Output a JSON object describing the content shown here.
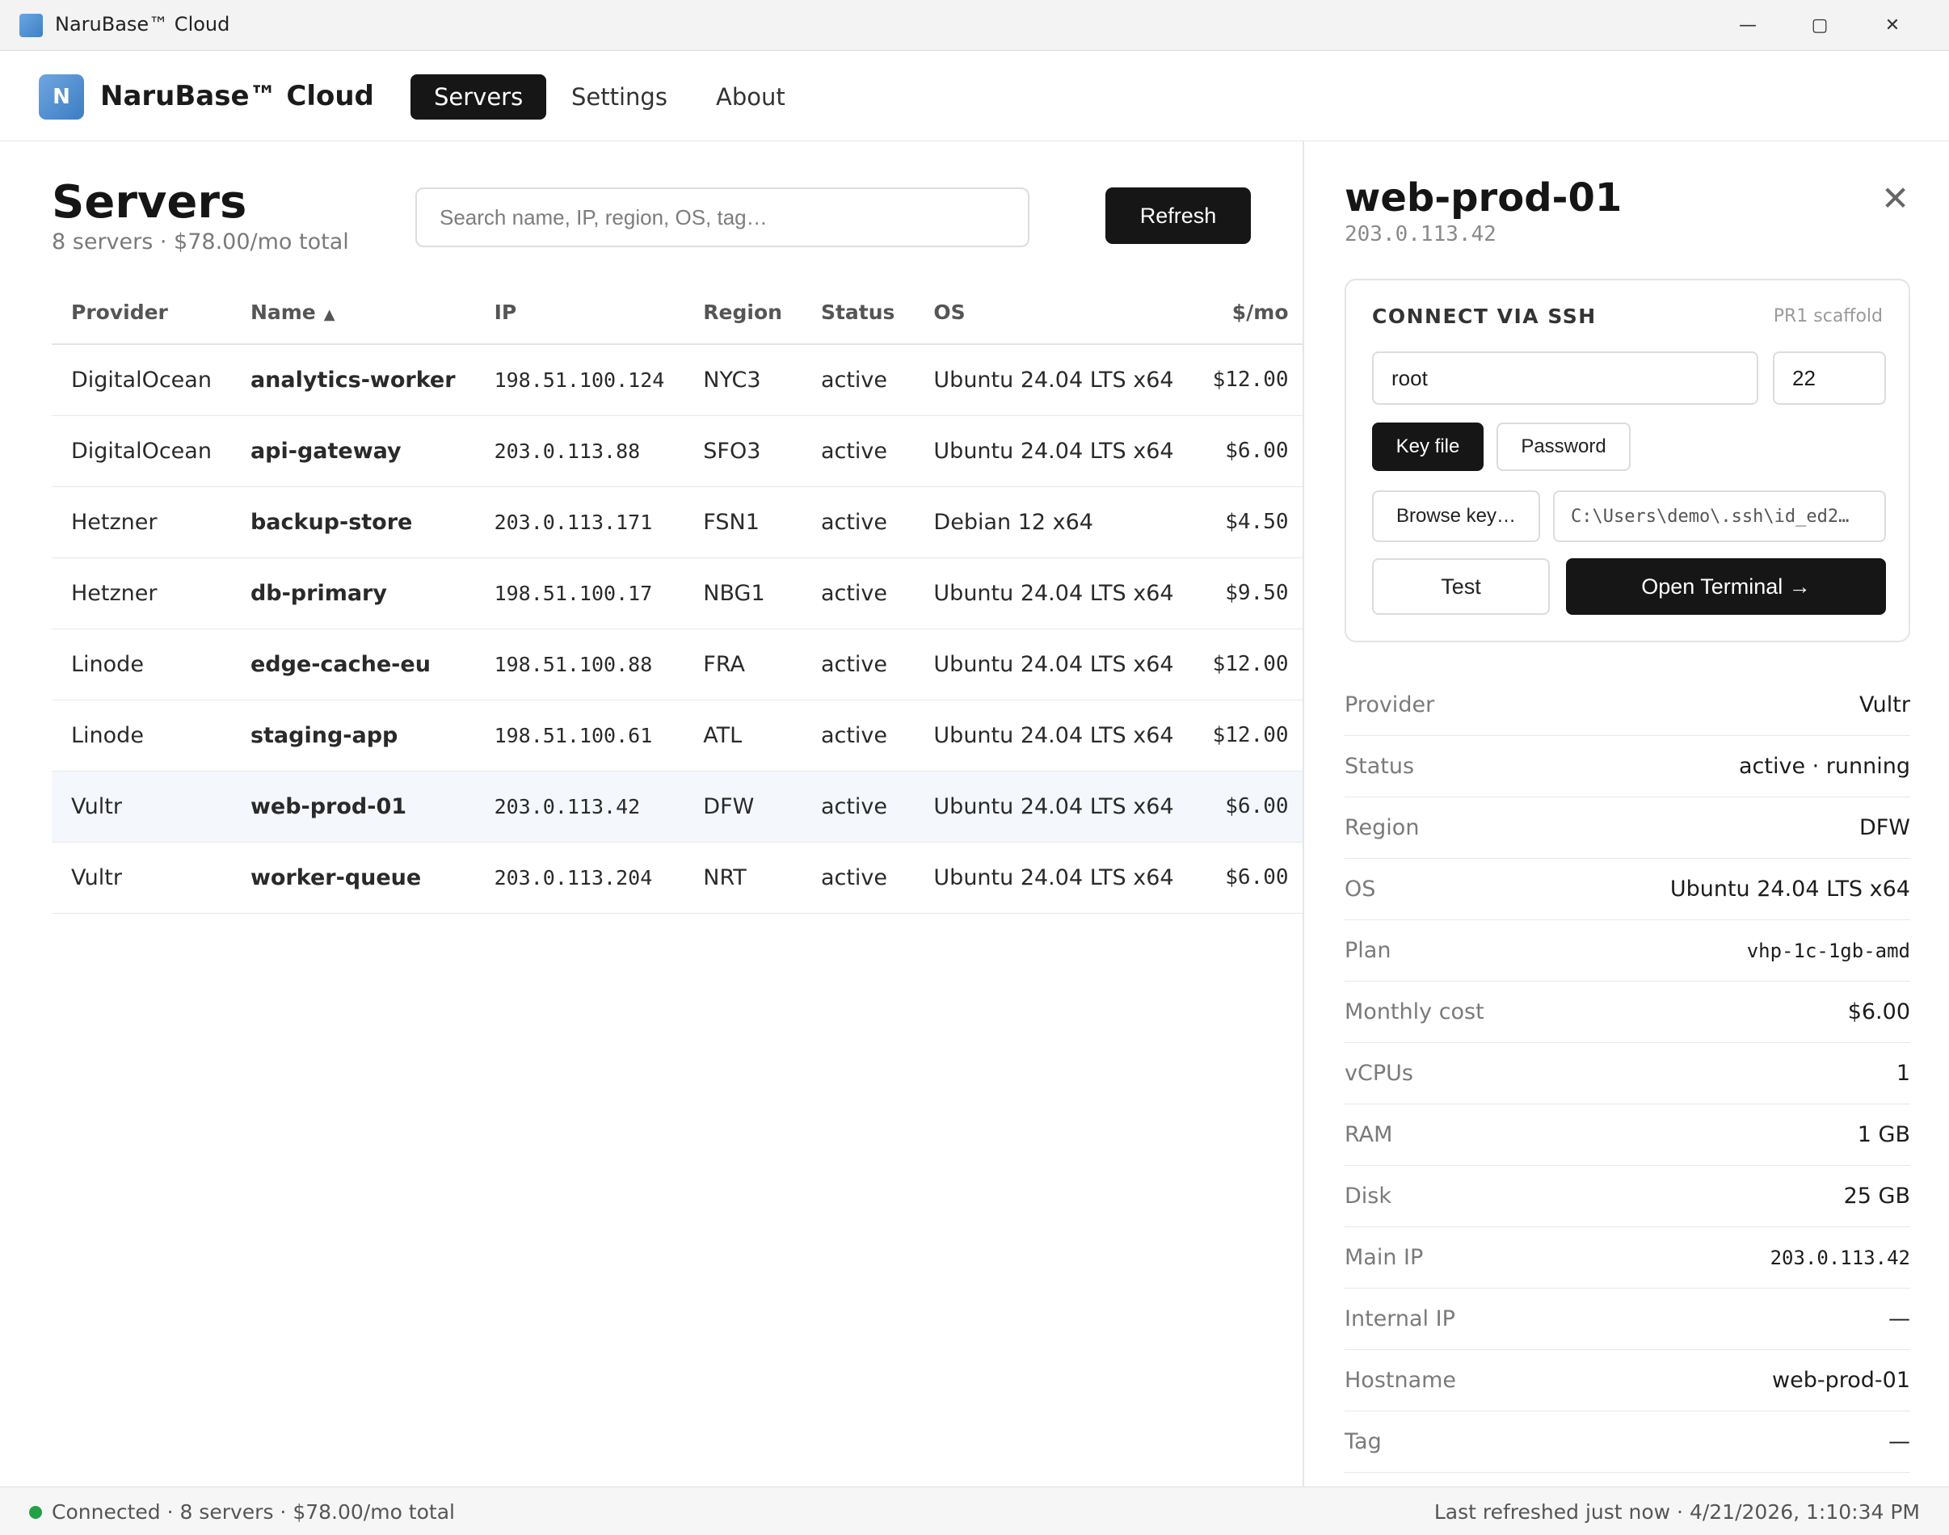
{
  "window": {
    "title": "NaruBase™ Cloud",
    "minimize_glyph": "—",
    "maximize_glyph": "▢",
    "close_glyph": "✕"
  },
  "nav": {
    "logo_letter": "N",
    "brand": "NaruBase™ Cloud",
    "tabs": [
      {
        "label": "Servers",
        "active": true
      },
      {
        "label": "Settings",
        "active": false
      },
      {
        "label": "About",
        "active": false
      }
    ]
  },
  "main": {
    "title": "Servers",
    "subtitle": "8 servers · $78.00/mo total",
    "search_placeholder": "Search name, IP, region, OS, tag…",
    "refresh_label": "Refresh",
    "sort_arrow": "▲",
    "columns": [
      "Provider",
      "Name",
      "IP",
      "Region",
      "Status",
      "OS",
      "$/mo"
    ],
    "rows": [
      {
        "provider": "DigitalOcean",
        "name": "analytics-worker",
        "ip": "198.51.100.124",
        "region": "NYC3",
        "status": "active",
        "os": "Ubuntu 24.04 LTS x64",
        "cost": "$12.00"
      },
      {
        "provider": "DigitalOcean",
        "name": "api-gateway",
        "ip": "203.0.113.88",
        "region": "SFO3",
        "status": "active",
        "os": "Ubuntu 24.04 LTS x64",
        "cost": "$6.00"
      },
      {
        "provider": "Hetzner",
        "name": "backup-store",
        "ip": "203.0.113.171",
        "region": "FSN1",
        "status": "active",
        "os": "Debian 12 x64",
        "cost": "$4.50"
      },
      {
        "provider": "Hetzner",
        "name": "db-primary",
        "ip": "198.51.100.17",
        "region": "NBG1",
        "status": "active",
        "os": "Ubuntu 24.04 LTS x64",
        "cost": "$9.50"
      },
      {
        "provider": "Linode",
        "name": "edge-cache-eu",
        "ip": "198.51.100.88",
        "region": "FRA",
        "status": "active",
        "os": "Ubuntu 24.04 LTS x64",
        "cost": "$12.00"
      },
      {
        "provider": "Linode",
        "name": "staging-app",
        "ip": "198.51.100.61",
        "region": "ATL",
        "status": "active",
        "os": "Ubuntu 24.04 LTS x64",
        "cost": "$12.00"
      },
      {
        "provider": "Vultr",
        "name": "web-prod-01",
        "ip": "203.0.113.42",
        "region": "DFW",
        "status": "active",
        "os": "Ubuntu 24.04 LTS x64",
        "cost": "$6.00",
        "selected": true
      },
      {
        "provider": "Vultr",
        "name": "worker-queue",
        "ip": "203.0.113.204",
        "region": "NRT",
        "status": "active",
        "os": "Ubuntu 24.04 LTS x64",
        "cost": "$6.00"
      }
    ]
  },
  "detail": {
    "title": "web-prod-01",
    "ip": "203.0.113.42",
    "close_glyph": "✕",
    "ssh": {
      "heading": "CONNECT VIA SSH",
      "hint": "PR1 scaffold",
      "username": "root",
      "port": "22",
      "key_file_label": "Key file",
      "password_label": "Password",
      "browse_label": "Browse key…",
      "key_path": "C:\\Users\\demo\\.ssh\\id_ed2…",
      "test_label": "Test",
      "open_terminal_label": "Open Terminal →"
    },
    "properties": [
      {
        "key": "Provider",
        "value": "Vultr"
      },
      {
        "key": "Status",
        "value": "active · running"
      },
      {
        "key": "Region",
        "value": "DFW"
      },
      {
        "key": "OS",
        "value": "Ubuntu 24.04 LTS x64"
      },
      {
        "key": "Plan",
        "value": "vhp-1c-1gb-amd",
        "mono": true
      },
      {
        "key": "Monthly cost",
        "value": "$6.00"
      },
      {
        "key": "vCPUs",
        "value": "1"
      },
      {
        "key": "RAM",
        "value": "1 GB"
      },
      {
        "key": "Disk",
        "value": "25 GB"
      },
      {
        "key": "Main IP",
        "value": "203.0.113.42",
        "mono": true
      },
      {
        "key": "Internal IP",
        "value": "—"
      },
      {
        "key": "Hostname",
        "value": "web-prod-01"
      },
      {
        "key": "Tag",
        "value": "—"
      }
    ]
  },
  "statusbar": {
    "left": "Connected · 8 servers · $78.00/mo total",
    "right": "Last refreshed just now · 4/21/2026, 1:10:34 PM",
    "connected_color": "#22a046"
  }
}
